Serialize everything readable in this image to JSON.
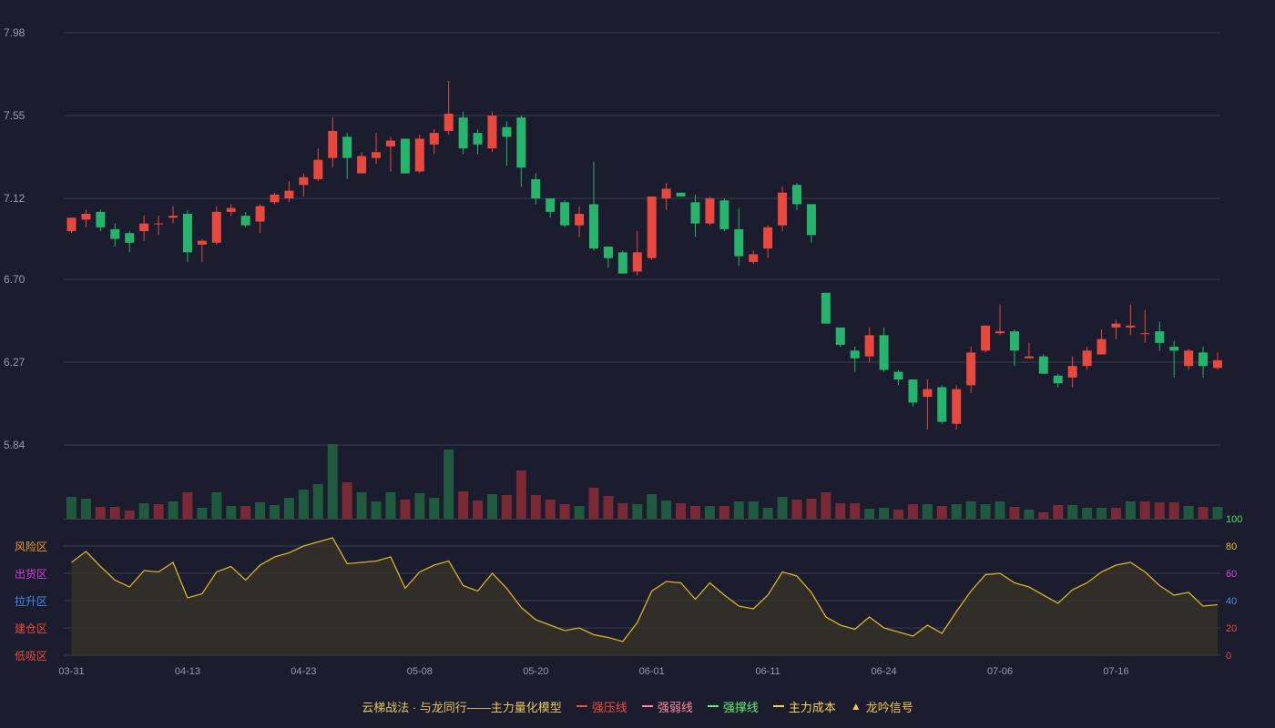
{
  "chart_data": [
    {
      "type": "candlestick",
      "y_ticks": [
        "7.98",
        "7.55",
        "7.12",
        "6.70",
        "6.27",
        "5.84"
      ],
      "ylim": [
        5.84,
        7.98
      ],
      "colors": {
        "up": "#e9483f",
        "down": "#26b36b",
        "grid": "#3a3c52",
        "text": "#9a9ba8"
      },
      "candles": [
        [
          6.95,
          7.02,
          6.94,
          6.95
        ],
        [
          7.01,
          7.04,
          7.06,
          6.97
        ],
        [
          7.05,
          6.97,
          7.06,
          6.95
        ],
        [
          6.96,
          6.91,
          6.99,
          6.87
        ],
        [
          6.94,
          6.89,
          6.95,
          6.84
        ],
        [
          6.95,
          6.99,
          7.03,
          6.9
        ],
        [
          6.99,
          6.99,
          7.03,
          6.93
        ],
        [
          7.02,
          7.03,
          7.08,
          6.99
        ],
        [
          7.04,
          6.84,
          7.06,
          6.79
        ],
        [
          6.88,
          6.9,
          6.91,
          6.79
        ],
        [
          6.89,
          7.05,
          7.08,
          6.88
        ],
        [
          7.05,
          7.07,
          7.09,
          7.03
        ],
        [
          7.03,
          6.98,
          7.05,
          6.97
        ],
        [
          7.0,
          7.08,
          7.09,
          6.94
        ],
        [
          7.1,
          7.14,
          7.15,
          7.09
        ],
        [
          7.12,
          7.16,
          7.21,
          7.1
        ],
        [
          7.19,
          7.23,
          7.25,
          7.13
        ],
        [
          7.22,
          7.32,
          7.38,
          7.21
        ],
        [
          7.33,
          7.47,
          7.54,
          7.28
        ],
        [
          7.44,
          7.33,
          7.46,
          7.22
        ],
        [
          7.25,
          7.34,
          7.36,
          7.25
        ],
        [
          7.33,
          7.36,
          7.46,
          7.3
        ],
        [
          7.39,
          7.42,
          7.44,
          7.26
        ],
        [
          7.43,
          7.25,
          7.43,
          7.25
        ],
        [
          7.26,
          7.43,
          7.45,
          7.25
        ],
        [
          7.4,
          7.46,
          7.48,
          7.35
        ],
        [
          7.47,
          7.56,
          7.73,
          7.45
        ],
        [
          7.54,
          7.38,
          7.57,
          7.35
        ],
        [
          7.46,
          7.4,
          7.48,
          7.35
        ],
        [
          7.38,
          7.55,
          7.57,
          7.36
        ],
        [
          7.49,
          7.44,
          7.52,
          7.29
        ],
        [
          7.54,
          7.28,
          7.55,
          7.18
        ],
        [
          7.22,
          7.12,
          7.25,
          7.09
        ],
        [
          7.12,
          7.05,
          7.12,
          7.02
        ],
        [
          7.1,
          6.98,
          7.11,
          6.97
        ],
        [
          6.98,
          7.04,
          7.08,
          6.92
        ],
        [
          7.09,
          6.86,
          7.31,
          6.85
        ],
        [
          6.87,
          6.81,
          6.87,
          6.76
        ],
        [
          6.84,
          6.73,
          6.85,
          6.73
        ],
        [
          6.74,
          6.84,
          6.95,
          6.72
        ],
        [
          6.81,
          7.13,
          7.13,
          6.8
        ],
        [
          7.12,
          7.17,
          7.2,
          7.06
        ],
        [
          7.15,
          7.13,
          7.15,
          7.13
        ],
        [
          7.1,
          6.99,
          7.14,
          6.92
        ],
        [
          6.99,
          7.12,
          7.13,
          6.98
        ],
        [
          7.11,
          6.96,
          7.12,
          6.95
        ],
        [
          6.96,
          6.82,
          7.07,
          6.77
        ],
        [
          6.79,
          6.83,
          6.85,
          6.78
        ],
        [
          6.86,
          6.97,
          6.98,
          6.81
        ],
        [
          6.98,
          7.15,
          7.18,
          6.95
        ],
        [
          7.19,
          7.09,
          7.2,
          7.06
        ],
        [
          7.09,
          6.93,
          7.09,
          6.89
        ],
        [
          6.63,
          6.47,
          6.63,
          6.47
        ],
        [
          6.45,
          6.36,
          6.45,
          6.35
        ],
        [
          6.33,
          6.29,
          6.35,
          6.22
        ],
        [
          6.3,
          6.41,
          6.45,
          6.27
        ],
        [
          6.41,
          6.23,
          6.45,
          6.22
        ],
        [
          6.22,
          6.18,
          6.23,
          6.15
        ],
        [
          6.18,
          6.06,
          6.18,
          6.04
        ],
        [
          6.09,
          6.13,
          6.18,
          5.92
        ],
        [
          6.14,
          5.96,
          6.15,
          5.95
        ],
        [
          5.95,
          6.13,
          6.15,
          5.92
        ],
        [
          6.15,
          6.32,
          6.35,
          6.11
        ],
        [
          6.33,
          6.46,
          6.46,
          6.32
        ],
        [
          6.42,
          6.43,
          6.57,
          6.41
        ],
        [
          6.43,
          6.33,
          6.44,
          6.25
        ],
        [
          6.29,
          6.3,
          6.37,
          6.29
        ],
        [
          6.3,
          6.21,
          6.31,
          6.21
        ],
        [
          6.2,
          6.16,
          6.21,
          6.14
        ],
        [
          6.19,
          6.25,
          6.3,
          6.14
        ],
        [
          6.25,
          6.33,
          6.35,
          6.23
        ],
        [
          6.31,
          6.39,
          6.44,
          6.31
        ],
        [
          6.45,
          6.47,
          6.49,
          6.39
        ],
        [
          6.45,
          6.46,
          6.57,
          6.41
        ],
        [
          6.42,
          6.42,
          6.54,
          6.37
        ],
        [
          6.43,
          6.37,
          6.48,
          6.33
        ],
        [
          6.35,
          6.33,
          6.38,
          6.19
        ],
        [
          6.25,
          6.33,
          6.34,
          6.23
        ],
        [
          6.32,
          6.25,
          6.35,
          6.19
        ],
        [
          6.24,
          6.28,
          6.32,
          6.23
        ]
      ],
      "volume": [
        [
          24,
          "d"
        ],
        [
          22,
          "d"
        ],
        [
          13,
          "u"
        ],
        [
          13,
          "u"
        ],
        [
          9,
          "u"
        ],
        [
          17,
          "d"
        ],
        [
          16,
          "u"
        ],
        [
          19,
          "d"
        ],
        [
          29,
          "u"
        ],
        [
          12,
          "d"
        ],
        [
          29,
          "d"
        ],
        [
          14,
          "d"
        ],
        [
          14,
          "u"
        ],
        [
          18,
          "d"
        ],
        [
          15,
          "d"
        ],
        [
          23,
          "d"
        ],
        [
          32,
          "d"
        ],
        [
          38,
          "d"
        ],
        [
          82,
          "d"
        ],
        [
          40,
          "u"
        ],
        [
          29,
          "d"
        ],
        [
          19,
          "d"
        ],
        [
          29,
          "d"
        ],
        [
          21,
          "u"
        ],
        [
          28,
          "d"
        ],
        [
          23,
          "d"
        ],
        [
          76,
          "d"
        ],
        [
          30,
          "u"
        ],
        [
          20,
          "u"
        ],
        [
          27,
          "d"
        ],
        [
          26,
          "u"
        ],
        [
          53,
          "u"
        ],
        [
          26,
          "u"
        ],
        [
          21,
          "u"
        ],
        [
          16,
          "u"
        ],
        [
          14,
          "d"
        ],
        [
          34,
          "u"
        ],
        [
          25,
          "u"
        ],
        [
          17,
          "u"
        ],
        [
          16,
          "d"
        ],
        [
          27,
          "d"
        ],
        [
          20,
          "d"
        ],
        [
          17,
          "u"
        ],
        [
          14,
          "u"
        ],
        [
          14,
          "d"
        ],
        [
          14,
          "u"
        ],
        [
          19,
          "d"
        ],
        [
          19,
          "d"
        ],
        [
          12,
          "d"
        ],
        [
          24,
          "d"
        ],
        [
          21,
          "u"
        ],
        [
          22,
          "u"
        ],
        [
          29,
          "u"
        ],
        [
          17,
          "u"
        ],
        [
          17,
          "u"
        ],
        [
          11,
          "d"
        ],
        [
          12,
          "d"
        ],
        [
          10,
          "u"
        ],
        [
          16,
          "u"
        ],
        [
          16,
          "d"
        ],
        [
          14,
          "u"
        ],
        [
          16,
          "d"
        ],
        [
          19,
          "d"
        ],
        [
          16,
          "d"
        ],
        [
          19,
          "d"
        ],
        [
          13,
          "u"
        ],
        [
          10,
          "d"
        ],
        [
          7,
          "u"
        ],
        [
          15,
          "u"
        ],
        [
          15,
          "d"
        ],
        [
          12,
          "d"
        ],
        [
          12,
          "d"
        ],
        [
          12,
          "u"
        ],
        [
          19,
          "d"
        ],
        [
          19,
          "u"
        ],
        [
          18,
          "u"
        ],
        [
          18,
          "u"
        ],
        [
          14,
          "d"
        ],
        [
          13,
          "u"
        ],
        [
          13,
          "d"
        ]
      ]
    },
    {
      "type": "area",
      "y_ticks_right": [
        "100",
        "80",
        "60",
        "40",
        "20",
        "0"
      ],
      "zones": [
        "风险区",
        "出货区",
        "拉升区",
        "建仓区",
        "低吸区"
      ],
      "zone_colors": [
        "#ef9a2b",
        "#d43fd6",
        "#3f8cf0",
        "#e9483f",
        "#e9483f"
      ],
      "tick_colors": [
        "#3de05a",
        "#e6c13a",
        "#d43fd6",
        "#3f8cf0",
        "#e9483f",
        "#e9483f"
      ],
      "ylim": [
        0,
        100
      ],
      "values": [
        68,
        76,
        65,
        55,
        50,
        62,
        61,
        68,
        42,
        45,
        61,
        65,
        55,
        66,
        72,
        75,
        80,
        83,
        86,
        67,
        68,
        69,
        72,
        49,
        61,
        66,
        69,
        51,
        47,
        60,
        49,
        35,
        26,
        22,
        18,
        20,
        15,
        13,
        10,
        24,
        47,
        54,
        53,
        41,
        53,
        44,
        36,
        34,
        44,
        61,
        58,
        46,
        28,
        22,
        19,
        28,
        20,
        17,
        14,
        22,
        16,
        32,
        47,
        59,
        60,
        53,
        50,
        44,
        38,
        48,
        53,
        61,
        66,
        68,
        61,
        51,
        44,
        46,
        36,
        37
      ]
    }
  ],
  "x_ticks": [
    "03-31",
    "04-13",
    "04-23",
    "05-08",
    "05-20",
    "06-01",
    "06-11",
    "06-24",
    "07-06",
    "07-16"
  ],
  "legend": {
    "title": "云梯战法 · 与龙同行——主力量化模型",
    "items": [
      {
        "label": "强压线",
        "color": "#f04a3f",
        "style": "solid"
      },
      {
        "label": "强弱线",
        "color": "#ff8aa0",
        "style": "dashed"
      },
      {
        "label": "强撑线",
        "color": "#5cf06b",
        "style": "solid"
      },
      {
        "label": "主力成本",
        "color": "#f3d54a",
        "style": "dashed"
      },
      {
        "label": "龙吟信号",
        "color": "#f3c94a",
        "style": "triangle"
      }
    ]
  }
}
